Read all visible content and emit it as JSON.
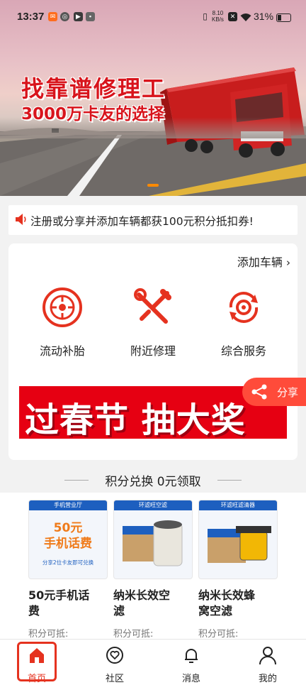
{
  "status_bar": {
    "time": "13:37",
    "speed_value": "8.10",
    "speed_unit": "KB/s",
    "battery": "31%"
  },
  "banner": {
    "headline": "找靠谱修理工",
    "subline": "3000万卡友的选择"
  },
  "notice": {
    "text": "注册或分享并添加车辆都获100元积分抵扣券!"
  },
  "services": {
    "add_vehicle": "添加车辆",
    "items": [
      {
        "label": "流动补胎",
        "icon": "tire-icon"
      },
      {
        "label": "附近修理",
        "icon": "wrench-screwdriver-icon"
      },
      {
        "label": "综合服务",
        "icon": "gear-cycle-icon"
      }
    ],
    "promo_text": "过春节 抽大奖",
    "share_label": "分享"
  },
  "exchange": {
    "title": "积分兑换 0元领取",
    "products": [
      {
        "name_line1": "50元手机话",
        "name_line2": "费",
        "points_label": "积分可抵:",
        "thumb_band": "手机营业厅",
        "thumb_big": "50元",
        "thumb_big2": "手机话费",
        "thumb_small": "分享2位卡友即可兑换"
      },
      {
        "name_line1": "纳米长效空",
        "name_line2": "滤",
        "points_label": "积分可抵:",
        "thumb_band": "环滤旺空滤"
      },
      {
        "name_line1": "纳米长效蜂",
        "name_line2": "窝空滤",
        "points_label": "积分可抵:",
        "thumb_band": "环滤旺滤清器"
      }
    ]
  },
  "tabbar": {
    "items": [
      {
        "label": "首页",
        "icon": "home-icon",
        "active": true
      },
      {
        "label": "社区",
        "icon": "heart-chat-icon",
        "active": false
      },
      {
        "label": "消息",
        "icon": "bell-icon",
        "active": false
      },
      {
        "label": "我的",
        "icon": "person-icon",
        "active": false
      }
    ]
  },
  "colors": {
    "accent": "#e5321f",
    "promo_red": "#e60012",
    "notice_icon": "#e5321f"
  }
}
